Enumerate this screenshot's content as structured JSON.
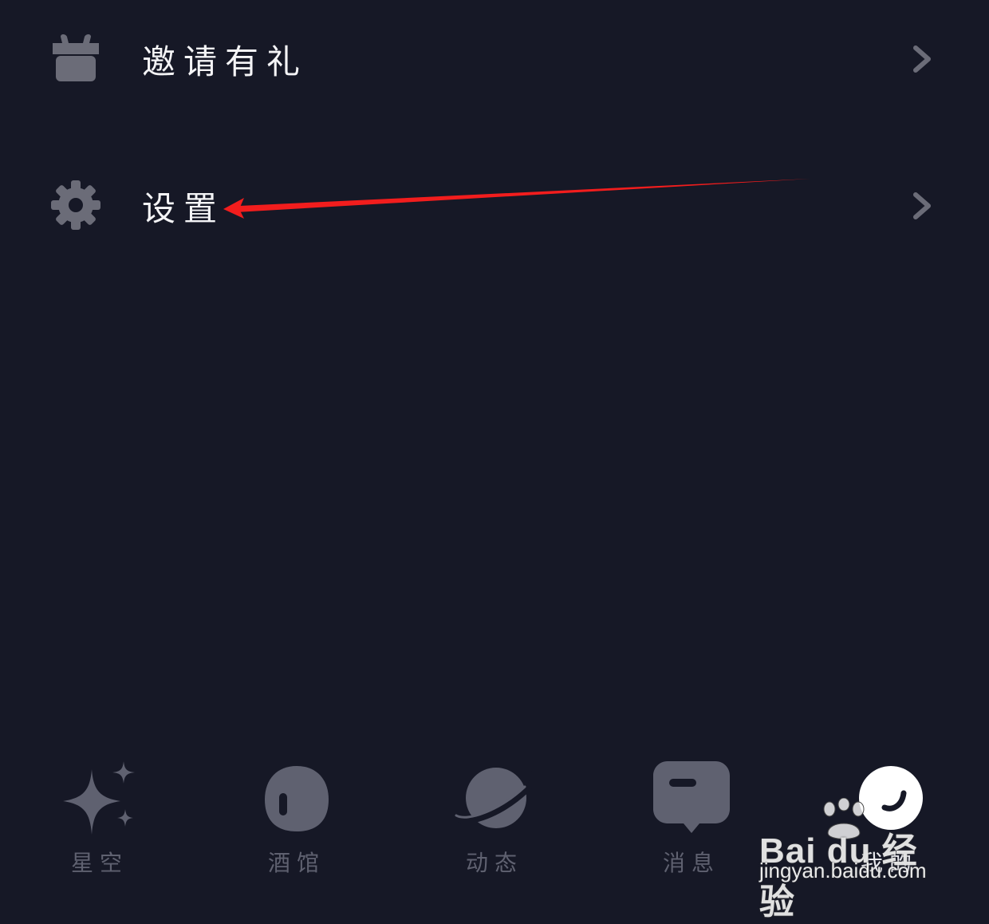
{
  "menu": {
    "items": [
      {
        "label": "邀请有礼",
        "icon": "gift-icon"
      },
      {
        "label": "设置",
        "icon": "gear-icon"
      }
    ]
  },
  "tabs": [
    {
      "label": "星空",
      "icon": "sparkle-icon"
    },
    {
      "label": "酒馆",
      "icon": "tavern-icon"
    },
    {
      "label": "动态",
      "icon": "planet-icon"
    },
    {
      "label": "消息",
      "icon": "message-bubble-icon"
    },
    {
      "label": "我的",
      "icon": "profile-icon",
      "active": true
    }
  ],
  "watermark": {
    "brand": "Bai du 经验",
    "url": "jingyan.baidu.com"
  },
  "colors": {
    "background": "#161826",
    "icon_gray": "#6b6c78",
    "annotation_red": "#f21d1d",
    "active_tab": "#ffffff"
  }
}
